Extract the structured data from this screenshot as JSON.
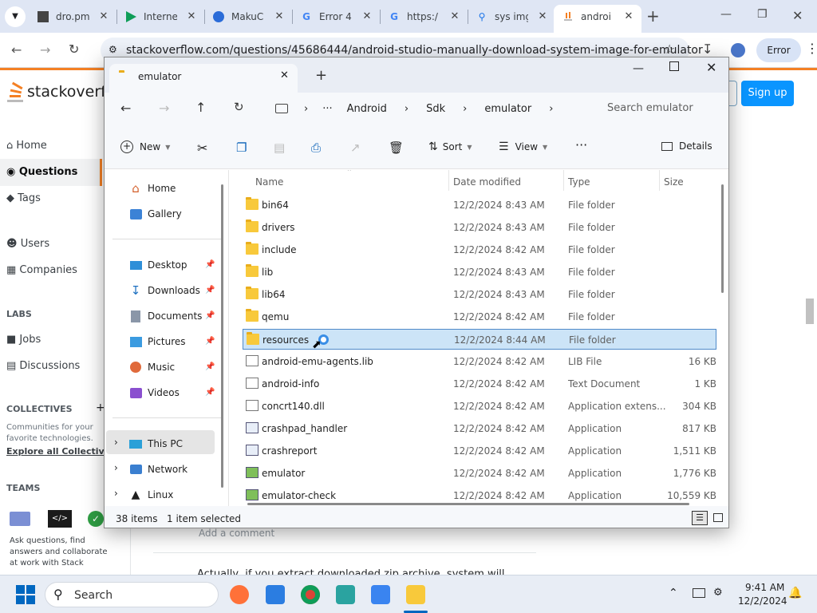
{
  "browser": {
    "tabs": [
      {
        "title": "dro.pm",
        "icon": "generic-site-icon"
      },
      {
        "title": "Interne",
        "icon": "play-store-icon"
      },
      {
        "title": "MakuC",
        "icon": "makuc-icon"
      },
      {
        "title": "Error 4",
        "icon": "google-icon"
      },
      {
        "title": "https:/",
        "icon": "google-icon"
      },
      {
        "title": "sys img",
        "icon": "search-icon"
      },
      {
        "title": "androi",
        "icon": "stackoverflow-icon",
        "active": true
      }
    ],
    "new_tab": "+",
    "url": "stackoverflow.com/questions/45686444/android-studio-manually-download-system-image-for-emulator",
    "error_badge": "Error"
  },
  "so": {
    "logo_text": "stackoverfl",
    "signup": "Sign up",
    "nav": [
      "Home",
      "Questions",
      "Tags",
      "Users",
      "Companies"
    ],
    "labs_heading": "LABS",
    "labs": [
      "Jobs",
      "Discussions"
    ],
    "collectives_heading": "COLLECTIVES",
    "collectives_text_1": "Communities for your",
    "collectives_text_2": "favorite technologies.",
    "collectives_link": "Explore all Collectives",
    "teams_heading": "TEAMS",
    "teams_text_1": "Ask questions, find",
    "teams_text_2": "answers and collaborate",
    "teams_text_3": "at work with Stack",
    "add_comment": "Add a comment",
    "answer_snippet": "Actually, if you extract downloaded zip archive, system will"
  },
  "explorer": {
    "tab_title": "emulator",
    "breadcrumb": [
      "Android",
      "Sdk",
      "emulator"
    ],
    "search_placeholder": "Search emulator",
    "commands": {
      "new": "New",
      "sort": "Sort",
      "view": "View",
      "details": "Details"
    },
    "sidebar": [
      {
        "label": "Home",
        "icon": "home-icon"
      },
      {
        "label": "Gallery",
        "icon": "gallery-icon"
      },
      {
        "label": "Desktop",
        "icon": "desktop-icon",
        "pinned": true
      },
      {
        "label": "Downloads",
        "icon": "download-icon",
        "pinned": true
      },
      {
        "label": "Documents",
        "icon": "documents-icon",
        "pinned": true
      },
      {
        "label": "Pictures",
        "icon": "pictures-icon",
        "pinned": true
      },
      {
        "label": "Music",
        "icon": "music-icon",
        "pinned": true
      },
      {
        "label": "Videos",
        "icon": "videos-icon",
        "pinned": true
      },
      {
        "label": "This PC",
        "icon": "pc-icon",
        "selected": true
      },
      {
        "label": "Network",
        "icon": "network-icon"
      },
      {
        "label": "Linux",
        "icon": "linux-icon"
      }
    ],
    "columns": {
      "name": "Name",
      "date": "Date modified",
      "type": "Type",
      "size": "Size"
    },
    "files": [
      {
        "name": "bin64",
        "date": "12/2/2024 8:43 AM",
        "type": "File folder",
        "size": "",
        "kind": "folder"
      },
      {
        "name": "drivers",
        "date": "12/2/2024 8:43 AM",
        "type": "File folder",
        "size": "",
        "kind": "folder"
      },
      {
        "name": "include",
        "date": "12/2/2024 8:42 AM",
        "type": "File folder",
        "size": "",
        "kind": "folder"
      },
      {
        "name": "lib",
        "date": "12/2/2024 8:43 AM",
        "type": "File folder",
        "size": "",
        "kind": "folder"
      },
      {
        "name": "lib64",
        "date": "12/2/2024 8:43 AM",
        "type": "File folder",
        "size": "",
        "kind": "folder"
      },
      {
        "name": "qemu",
        "date": "12/2/2024 8:42 AM",
        "type": "File folder",
        "size": "",
        "kind": "folder"
      },
      {
        "name": "resources",
        "date": "12/2/2024 8:44 AM",
        "type": "File folder",
        "size": "",
        "kind": "folder",
        "selected": true
      },
      {
        "name": "android-emu-agents.lib",
        "date": "12/2/2024 8:42 AM",
        "type": "LIB File",
        "size": "16 KB",
        "kind": "doc"
      },
      {
        "name": "android-info",
        "date": "12/2/2024 8:42 AM",
        "type": "Text Document",
        "size": "1 KB",
        "kind": "doc"
      },
      {
        "name": "concrt140.dll",
        "date": "12/2/2024 8:42 AM",
        "type": "Application extens...",
        "size": "304 KB",
        "kind": "doc"
      },
      {
        "name": "crashpad_handler",
        "date": "12/2/2024 8:42 AM",
        "type": "Application",
        "size": "817 KB",
        "kind": "app"
      },
      {
        "name": "crashreport",
        "date": "12/2/2024 8:42 AM",
        "type": "Application",
        "size": "1,511 KB",
        "kind": "app"
      },
      {
        "name": "emulator",
        "date": "12/2/2024 8:42 AM",
        "type": "Application",
        "size": "1,776 KB",
        "kind": "app"
      },
      {
        "name": "emulator-check",
        "date": "12/2/2024 8:42 AM",
        "type": "Application",
        "size": "10,559 KB",
        "kind": "app"
      }
    ],
    "status_count": "38 items",
    "status_selected": "1 item selected"
  },
  "taskbar": {
    "search": "Search",
    "time": "9:41 AM",
    "date": "12/2/2024"
  },
  "colors": {
    "accent": "#0a95ff",
    "selection": "#cce4f7",
    "folder": "#f8c93b"
  }
}
